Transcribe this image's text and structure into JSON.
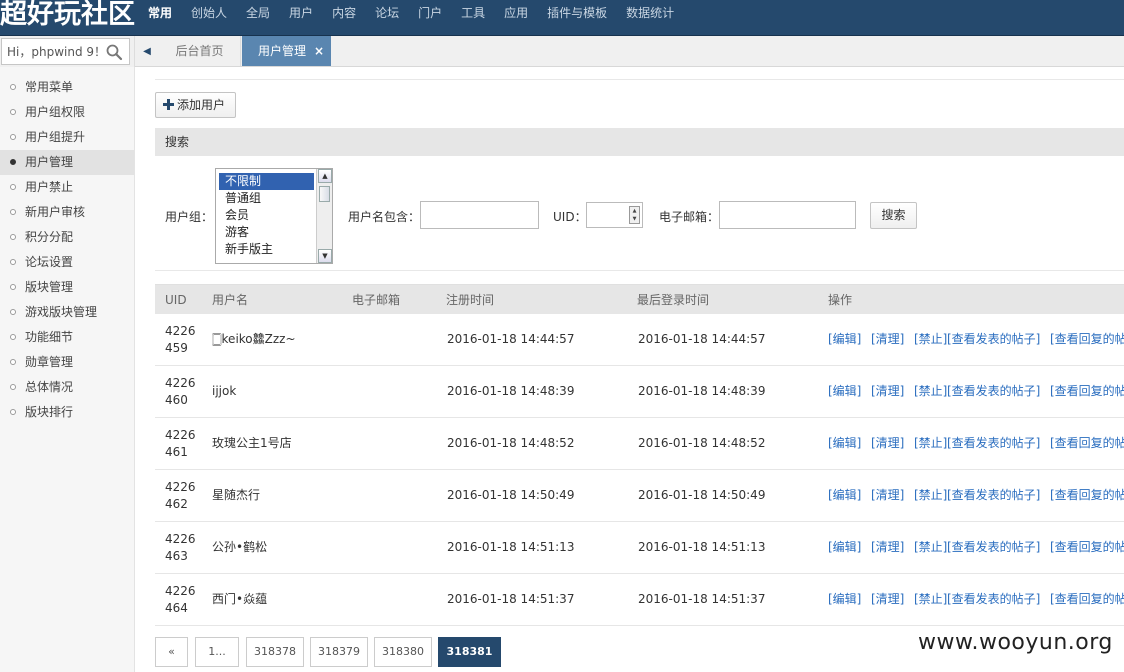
{
  "app": {
    "logo_text": "超好玩社区",
    "top_nav": [
      "常用",
      "创始人",
      "全局",
      "用户",
      "内容",
      "论坛",
      "门户",
      "工具",
      "应用",
      "插件与模板",
      "数据统计"
    ]
  },
  "search": {
    "value": "Hi，phpwind 9！"
  },
  "tabs": [
    {
      "label": "后台首页"
    },
    {
      "label": "用户管理",
      "close": "×"
    }
  ],
  "sidebar": {
    "items": [
      {
        "label": "常用菜单"
      },
      {
        "label": "用户组权限"
      },
      {
        "label": "用户组提升"
      },
      {
        "label": "用户管理",
        "active": true
      },
      {
        "label": "用户禁止"
      },
      {
        "label": "新用户审核"
      },
      {
        "label": "积分分配"
      },
      {
        "label": "论坛设置"
      },
      {
        "label": "版块管理"
      },
      {
        "label": "游戏版块管理"
      },
      {
        "label": "功能细节"
      },
      {
        "label": "勋章管理"
      },
      {
        "label": "总体情况"
      },
      {
        "label": "版块排行"
      }
    ]
  },
  "toolbar": {
    "add_user_label": "添加用户"
  },
  "search_panel": {
    "header": "搜索",
    "group_label": "用户组：",
    "group_options": [
      "不限制",
      "普通组",
      "会员",
      "游客",
      "新手版主"
    ],
    "username_label": "用户名包含：",
    "uid_label": "UID：",
    "email_label": "电子邮箱：",
    "search_button": "搜索"
  },
  "table": {
    "headers": {
      "uid": "UID",
      "username": "用户名",
      "email": "电子邮箱",
      "reg_time": "注册时间",
      "last_login": "最后登录时间",
      "actions": "操作"
    },
    "actions": {
      "edit": "[编辑]",
      "clean": "[清理]",
      "ban": "[禁止]",
      "view_posts": "[查看发表的帖子]",
      "view_replies": "[查看回复的帖"
    },
    "rows": [
      {
        "uid_a": "4226",
        "uid_b": "459",
        "username": "🀆keiko䲜Zzz~",
        "email": "",
        "reg_time": "2016-01-18 14:44:57",
        "last_login": "2016-01-18 14:44:57"
      },
      {
        "uid_a": "4226",
        "uid_b": "460",
        "username": "ijjok",
        "email": "",
        "reg_time": "2016-01-18 14:48:39",
        "last_login": "2016-01-18 14:48:39"
      },
      {
        "uid_a": "4226",
        "uid_b": "461",
        "username": "玫瑰公主1号店",
        "email": "",
        "reg_time": "2016-01-18 14:48:52",
        "last_login": "2016-01-18 14:48:52"
      },
      {
        "uid_a": "4226",
        "uid_b": "462",
        "username": "星随杰行",
        "email": "",
        "reg_time": "2016-01-18 14:50:49",
        "last_login": "2016-01-18 14:50:49"
      },
      {
        "uid_a": "4226",
        "uid_b": "463",
        "username": "公孙•鹤松",
        "email": "",
        "reg_time": "2016-01-18 14:51:13",
        "last_login": "2016-01-18 14:51:13"
      },
      {
        "uid_a": "4226",
        "uid_b": "464",
        "username": "西门•焱蕴",
        "email": "",
        "reg_time": "2016-01-18 14:51:37",
        "last_login": "2016-01-18 14:51:37"
      }
    ]
  },
  "pagination": {
    "first": "«",
    "ellipsis": "1...",
    "pages": [
      "318378",
      "318379",
      "318380"
    ],
    "current": "318381"
  },
  "watermark": "www.wooyun.org",
  "colors": {
    "topbar": "#25496d",
    "tab_active": "#5a86b0",
    "link": "#2a6dbf"
  }
}
